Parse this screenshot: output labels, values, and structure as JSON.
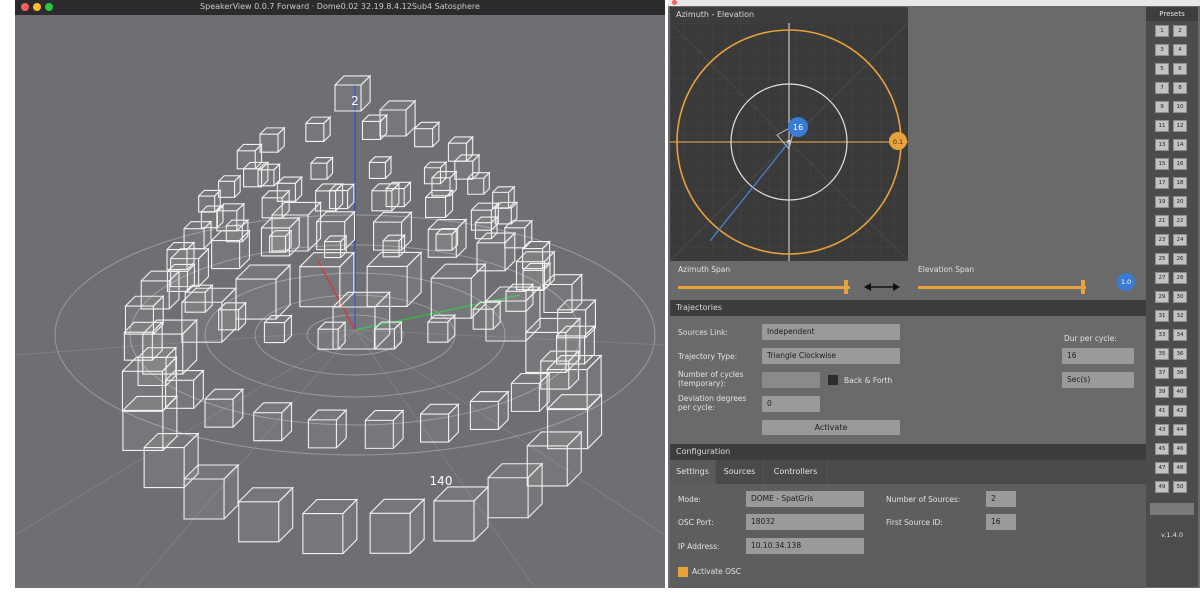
{
  "speaker_view": {
    "title": "SpeakerView 0.0.7 Forward · Dome0.02 32.19.8.4.12Sub4 Satosphere",
    "traffic_lights": [
      "#ff5f57",
      "#febc2e",
      "#28c840"
    ],
    "labels": {
      "top_speaker": "2",
      "front_speaker": "140"
    }
  },
  "control_gris": {
    "azel_panel": {
      "title": "Azimuth - Elevation",
      "source_label": "16",
      "handle_label": "0.1"
    },
    "sliders": {
      "azimuth_span_label": "Azimuth Span",
      "elevation_span_label": "Elevation Span",
      "link_icon": "double-arrow-icon",
      "right_badge": "1.0"
    },
    "trajectories": {
      "title": "Trajectories",
      "source_link_label": "Sources Link:",
      "source_link_value": "Independent",
      "trajectory_type_label": "Trajectory Type:",
      "trajectory_type_value": "Triangle Clockwise",
      "cycles_label": "Number of cycles (temporary):",
      "cycles_value": "",
      "back_forth_label": "Back & Forth",
      "deviation_label": "Deviation degrees per cycle:",
      "deviation_value": "0",
      "activate_label": "Activate",
      "dur_label": "Dur per cycle:",
      "dur_value": "16",
      "dur_unit": "Sec(s)"
    },
    "configuration": {
      "title": "Configuration",
      "tabs": [
        "Settings",
        "Sources",
        "Controllers"
      ],
      "mode_label": "Mode:",
      "mode_value": "DOME - SpatGris",
      "osc_port_label": "OSC Port:",
      "osc_port_value": "18032",
      "ip_label": "IP Address:",
      "ip_value": "10.10.34.138",
      "num_sources_label": "Number of Sources:",
      "num_sources_value": "2",
      "first_source_label": "First Source ID:",
      "first_source_value": "16",
      "activate_osc_label": "Activate OSC"
    },
    "presets": {
      "title": "Presets",
      "buttons": [
        "1",
        "2",
        "3",
        "4",
        "5",
        "6",
        "7",
        "8",
        "9",
        "10",
        "11",
        "12",
        "13",
        "14",
        "15",
        "16",
        "17",
        "18",
        "19",
        "20",
        "21",
        "22",
        "23",
        "24",
        "25",
        "26",
        "27",
        "28",
        "29",
        "30",
        "31",
        "32",
        "33",
        "34",
        "35",
        "36",
        "37",
        "38",
        "39",
        "40",
        "41",
        "42",
        "43",
        "44",
        "45",
        "46",
        "47",
        "48",
        "49",
        "50"
      ],
      "footer": "v.1.4.0"
    },
    "colors": {
      "accent_orange": "#e8a23c",
      "source_blue": "#3a7bd5",
      "panel_dark": "#3d3d3d"
    }
  }
}
